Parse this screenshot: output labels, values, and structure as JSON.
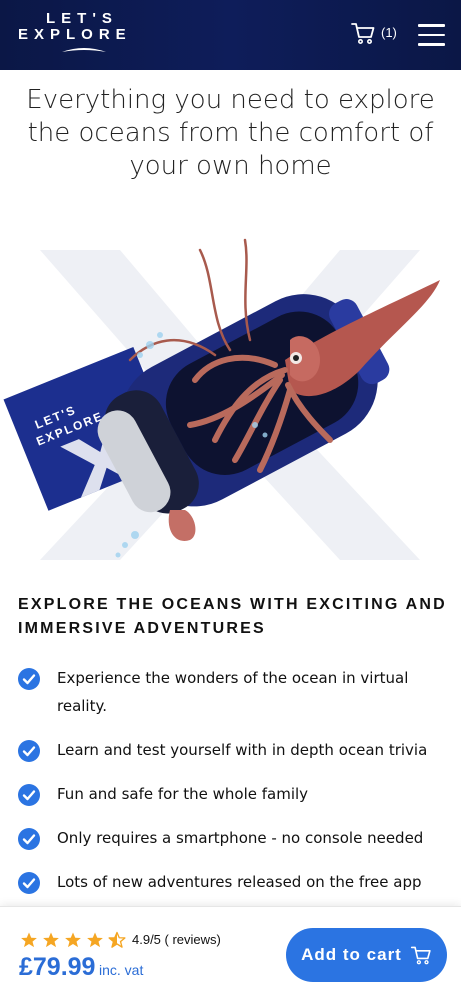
{
  "header": {
    "logo_line1": "LET'S",
    "logo_line2": "EXPLORE",
    "cart_count": "(1)",
    "cart_icon": "shopping-cart-icon",
    "menu_icon": "hamburger-menu-icon",
    "background_color": "#0e1d5a"
  },
  "hero": {
    "title": "Everything you need to explore the oceans from the comfort of your own home",
    "image_description_icon": "vr-headset-squid-illustration"
  },
  "section": {
    "title": "EXPLORE THE OCEANS WITH EXCITING AND IMMERSIVE ADVENTURES"
  },
  "features": [
    "Experience the wonders of the ocean in virtual reality.",
    "Learn and test yourself with in depth ocean trivia",
    "Fun and safe for the whole family",
    "Only requires a smartphone - no console needed",
    "Lots of new adventures released on the free app"
  ],
  "purchase": {
    "rating": "4.9/5 ( reviews)",
    "rating_value": 4.5,
    "rating_max": 5,
    "price": "£79.99",
    "price_suffix": "inc. vat",
    "add_to_cart_label": "Add to cart",
    "accent_color": "#2b74e2",
    "star_color": "#f5a623"
  }
}
